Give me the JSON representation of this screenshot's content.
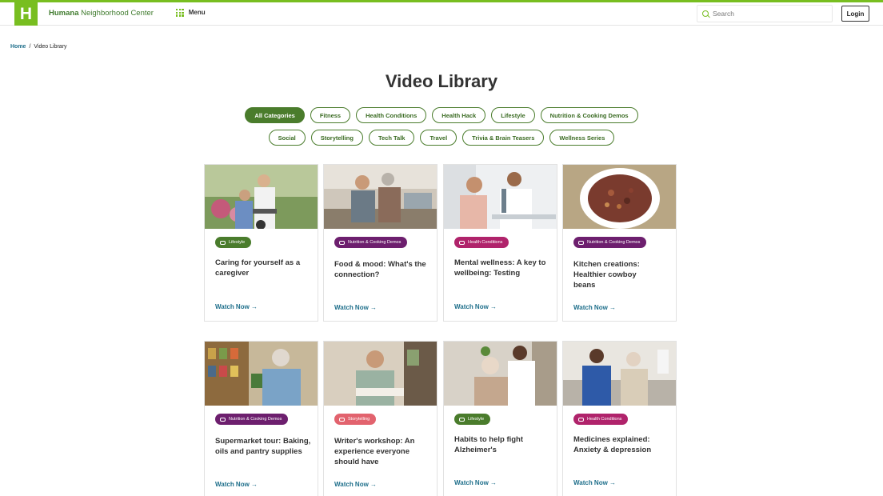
{
  "header": {
    "logo_letter": "H",
    "brand_bold": "Humana",
    "brand_rest": " Neighborhood Center",
    "menu_label": "Menu",
    "search_placeholder": "Search",
    "login_label": "Login"
  },
  "breadcrumb": {
    "home": "Home",
    "separator": "/",
    "current": "Video Library"
  },
  "page_title": "Video Library",
  "filters": {
    "row1": [
      "All Categories",
      "Fitness",
      "Health Conditions",
      "Health Hack",
      "Lifestyle",
      "Nutrition & Cooking Demos"
    ],
    "row2": [
      "Social",
      "Storytelling",
      "Tech Talk",
      "Travel",
      "Trivia & Brain Teasers",
      "Wellness Series"
    ]
  },
  "cards": [
    {
      "tag": "Lifestyle",
      "title": "Caring for yourself as a caregiver",
      "watch": "Watch Now →"
    },
    {
      "tag": "Nutrition & Cooking Demos",
      "title": "Food & mood: What's the connection?",
      "watch": "Watch Now →"
    },
    {
      "tag": "Health Conditions",
      "title": "Mental wellness: A key to wellbeing: Testing",
      "watch": "Watch Now →"
    },
    {
      "tag": "Nutrition & Cooking Demos",
      "title": "Kitchen creations: Healthier cowboy beans",
      "watch": "Watch Now →"
    },
    {
      "tag": "Nutrition & Cooking Demos",
      "title": "Supermarket tour: Baking, oils and pantry supplies",
      "watch": "Watch Now →"
    },
    {
      "tag": "Storytelling",
      "title": "Writer's workshop: An experience everyone should have",
      "watch": "Watch Now →"
    },
    {
      "tag": "Lifestyle",
      "title": "Habits to help fight Alzheimer's",
      "watch": "Watch Now →"
    },
    {
      "tag": "Health Conditions",
      "title": "Medicines explained: Anxiety & depression",
      "watch": "Watch Now →"
    }
  ],
  "colors": {
    "brand_green": "#78be20",
    "dark_green": "#4a7c2c",
    "lifestyle": "#4a7c2c",
    "nutrition": "#6d1f6e",
    "health_conditions": "#b0236b",
    "storytelling": "#e2636e",
    "link_teal": "#1f6f8b"
  }
}
